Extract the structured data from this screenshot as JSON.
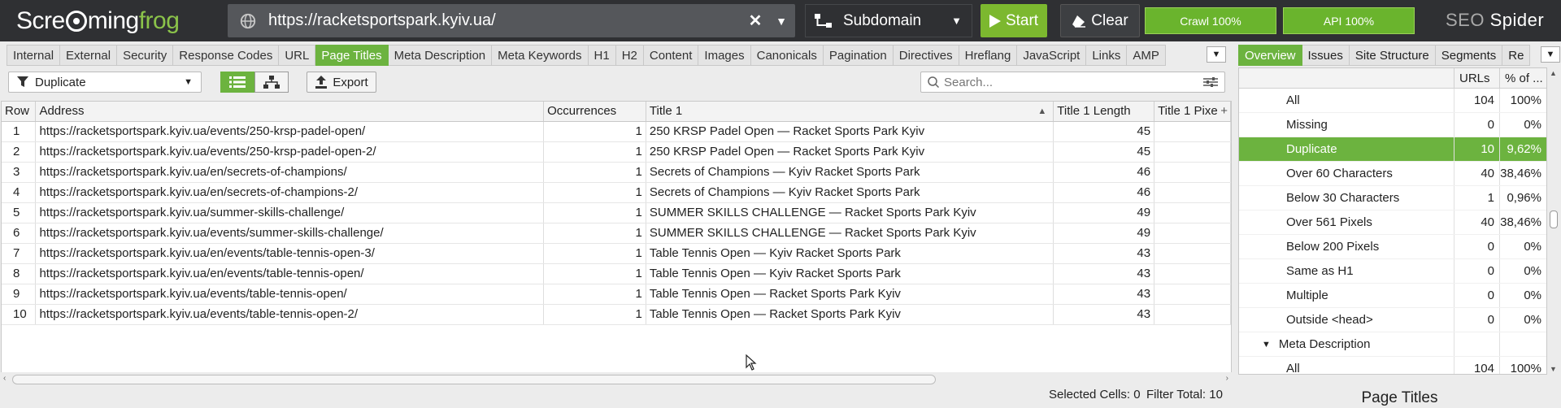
{
  "app": {
    "logo_part1": "Scre",
    "logo_part2": "ming",
    "logo_part3": "frog",
    "product_name_1": "SEO",
    "product_name_2": " Spider"
  },
  "toolbar": {
    "url_value": "https://racketsportspark.kyiv.ua/",
    "mode_label": "Subdomain",
    "start_label": "Start",
    "clear_label": "Clear",
    "crawl_progress_label": "Crawl 100%",
    "api_progress_label": "API 100%",
    "crawl_progress": 100,
    "api_progress": 100
  },
  "main_tabs": [
    "Internal",
    "External",
    "Security",
    "Response Codes",
    "URL",
    "Page Titles",
    "Meta Description",
    "Meta Keywords",
    "H1",
    "H2",
    "Content",
    "Images",
    "Canonicals",
    "Pagination",
    "Directives",
    "Hreflang",
    "JavaScript",
    "Links",
    "AMP"
  ],
  "active_main_tab": "Page Titles",
  "filter": {
    "selected": "Duplicate",
    "export_label": "Export",
    "search_placeholder": "Search..."
  },
  "table": {
    "columns": [
      "Row",
      "Address",
      "Occurrences",
      "Title 1",
      "Title 1 Length",
      "Title 1 Pixe"
    ],
    "rows": [
      [
        "1",
        "https://racketsportspark.kyiv.ua/events/250-krsp-padel-open/",
        "1",
        "250 KRSP Padel Open — Racket Sports Park Kyiv",
        "45",
        ""
      ],
      [
        "2",
        "https://racketsportspark.kyiv.ua/events/250-krsp-padel-open-2/",
        "1",
        "250 KRSP Padel Open — Racket Sports Park Kyiv",
        "45",
        ""
      ],
      [
        "3",
        "https://racketsportspark.kyiv.ua/en/secrets-of-champions/",
        "1",
        "Secrets of Champions — Kyiv Racket Sports Park",
        "46",
        ""
      ],
      [
        "4",
        "https://racketsportspark.kyiv.ua/en/secrets-of-champions-2/",
        "1",
        "Secrets of Champions — Kyiv Racket Sports Park",
        "46",
        ""
      ],
      [
        "5",
        "https://racketsportspark.kyiv.ua/summer-skills-challenge/",
        "1",
        "SUMMER SKILLS CHALLENGE — Racket Sports Park Kyiv",
        "49",
        ""
      ],
      [
        "6",
        "https://racketsportspark.kyiv.ua/events/summer-skills-challenge/",
        "1",
        "SUMMER SKILLS CHALLENGE — Racket Sports Park Kyiv",
        "49",
        ""
      ],
      [
        "7",
        "https://racketsportspark.kyiv.ua/en/events/table-tennis-open-3/",
        "1",
        "Table Tennis Open — Kyiv Racket Sports Park",
        "43",
        ""
      ],
      [
        "8",
        "https://racketsportspark.kyiv.ua/en/events/table-tennis-open/",
        "1",
        "Table Tennis Open — Kyiv Racket Sports Park",
        "43",
        ""
      ],
      [
        "9",
        "https://racketsportspark.kyiv.ua/events/table-tennis-open/",
        "1",
        "Table Tennis Open — Racket Sports Park Kyiv",
        "43",
        ""
      ],
      [
        "10",
        "https://racketsportspark.kyiv.ua/events/table-tennis-open-2/",
        "1",
        "Table Tennis Open — Racket Sports Park Kyiv",
        "43",
        ""
      ]
    ]
  },
  "status": {
    "selected_cells_label": "Selected Cells:",
    "selected_cells": "0",
    "filter_total_label": "Filter Total:",
    "filter_total": "10"
  },
  "right_panel": {
    "tabs": [
      "Overview",
      "Issues",
      "Site Structure",
      "Segments",
      "Re"
    ],
    "active_tab": "Overview",
    "col_urls": "URLs",
    "col_pct": "% of ...",
    "rows": [
      {
        "label": "All",
        "urls": "104",
        "pct": "100%",
        "selected": false,
        "group": false
      },
      {
        "label": "Missing",
        "urls": "0",
        "pct": "0%",
        "selected": false,
        "group": false
      },
      {
        "label": "Duplicate",
        "urls": "10",
        "pct": "9,62%",
        "selected": true,
        "group": false
      },
      {
        "label": "Over 60 Characters",
        "urls": "40",
        "pct": "38,46%",
        "selected": false,
        "group": false
      },
      {
        "label": "Below 30 Characters",
        "urls": "1",
        "pct": "0,96%",
        "selected": false,
        "group": false
      },
      {
        "label": "Over 561 Pixels",
        "urls": "40",
        "pct": "38,46%",
        "selected": false,
        "group": false
      },
      {
        "label": "Below 200 Pixels",
        "urls": "0",
        "pct": "0%",
        "selected": false,
        "group": false
      },
      {
        "label": "Same as H1",
        "urls": "0",
        "pct": "0%",
        "selected": false,
        "group": false
      },
      {
        "label": "Multiple",
        "urls": "0",
        "pct": "0%",
        "selected": false,
        "group": false
      },
      {
        "label": "Outside <head>",
        "urls": "0",
        "pct": "0%",
        "selected": false,
        "group": false
      },
      {
        "label": "Meta Description",
        "urls": "",
        "pct": "",
        "selected": false,
        "group": true
      },
      {
        "label": "All",
        "urls": "104",
        "pct": "100%",
        "selected": false,
        "group": false
      }
    ],
    "bottom_title": "Page Titles"
  },
  "colors": {
    "accent_green": "#6cb33f",
    "topbar_bg": "#2f3033"
  }
}
